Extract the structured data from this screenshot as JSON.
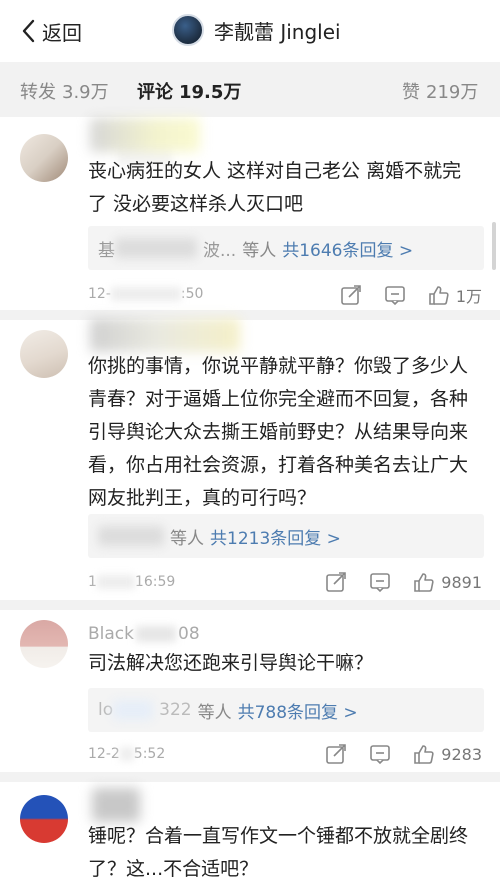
{
  "header": {
    "back_label": "返回",
    "profile_name": "李靓蕾 Jinglei"
  },
  "stats": {
    "repost_label": "转发",
    "repost_count": "3.9万",
    "comment_label": "评论",
    "comment_count": "19.5万",
    "like_label": "赞",
    "like_count": "219万"
  },
  "comments": [
    {
      "text": "丧心病狂的女人 这样对自己老公 离婚不就完了 没必要这样杀人灭口吧",
      "reply_prefix": "基",
      "reply_prefix2": "波...",
      "reply_suffix": "等人",
      "reply_count": "共1646条回复 >",
      "time": "12-",
      "time2": ":50",
      "like_count": "1万"
    },
    {
      "text": "你挑的事情，你说平静就平静？你毁了多少人青春？对于逼婚上位你完全避而不回复，各种引导舆论大众去撕王婚前野史？从结果导向来看，你占用社会资源，打着各种美名去让广大网友批判王，真的可行吗？",
      "reply_suffix": "等人",
      "reply_count": "共1213条回复 >",
      "time": "1",
      "time2": "16:59",
      "like_count": "9891"
    },
    {
      "name_hint": "Black",
      "name_hint2": "08",
      "text": "司法解决您还跑来引导舆论干嘛？",
      "reply_prefix": "lo",
      "reply_prefix2": "322",
      "reply_suffix": "等人",
      "reply_count": "共788条回复 >",
      "time": "12-2",
      "time2": "5:52",
      "like_count": "9283"
    },
    {
      "text": "锤呢？合着一直写作文一个锤都不放就全剧终了？这...不合适吧？"
    }
  ],
  "icons": {
    "back": "chevron-left-icon",
    "share": "share-icon",
    "comment": "comment-icon",
    "like": "thumbs-up-icon"
  },
  "colors": {
    "reply_count": "#4d7cb0",
    "stat_bar_bg": "#f2f2f2"
  }
}
